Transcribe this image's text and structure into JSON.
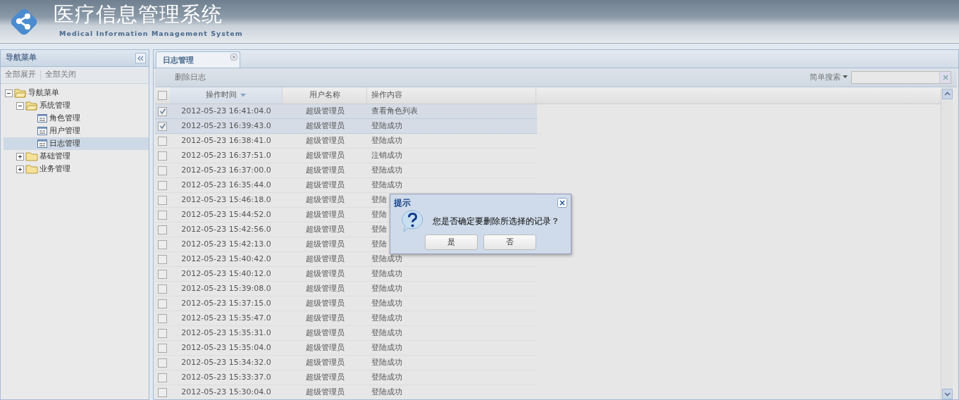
{
  "header": {
    "title": "医疗信息管理系统",
    "subtitle": "Medical Information Management System"
  },
  "sidebar": {
    "title": "导航菜单",
    "actions": [
      "全部展开",
      "全部关闭"
    ],
    "tree": [
      {
        "label": "导航菜单",
        "kind": "folder",
        "expanded": true,
        "selected": false,
        "children": [
          {
            "label": "系统管理",
            "kind": "folder",
            "expanded": true,
            "selected": false,
            "children": [
              {
                "label": "角色管理",
                "kind": "page",
                "selected": false
              },
              {
                "label": "用户管理",
                "kind": "page",
                "selected": false
              },
              {
                "label": "日志管理",
                "kind": "page",
                "selected": true
              }
            ]
          },
          {
            "label": "基础管理",
            "kind": "folder",
            "expanded": false,
            "selected": false
          },
          {
            "label": "业务管理",
            "kind": "folder",
            "expanded": false,
            "selected": false
          }
        ]
      }
    ]
  },
  "tabs": [
    {
      "label": "日志管理",
      "selected": true
    }
  ],
  "toolbar": {
    "delete": "删除日志",
    "search_menu": "简单搜索"
  },
  "table": {
    "all_checked": false,
    "columns": [
      {
        "label": "操作时间",
        "sorted": true
      },
      {
        "label": "用户名称",
        "sorted": false
      },
      {
        "label": "操作内容",
        "sorted": false
      }
    ],
    "rows": [
      {
        "time": "2012-05-23 16:41:04.0",
        "user": "超级管理员",
        "content": "查看角色列表",
        "checked": true
      },
      {
        "time": "2012-05-23 16:39:43.0",
        "user": "超级管理员",
        "content": "登陆成功",
        "checked": true
      },
      {
        "time": "2012-05-23 16:38:41.0",
        "user": "超级管理员",
        "content": "登陆成功",
        "checked": false
      },
      {
        "time": "2012-05-23 16:37:51.0",
        "user": "超级管理员",
        "content": "注销成功",
        "checked": false
      },
      {
        "time": "2012-05-23 16:37:00.0",
        "user": "超级管理员",
        "content": "登陆成功",
        "checked": false
      },
      {
        "time": "2012-05-23 16:35:44.0",
        "user": "超级管理员",
        "content": "登陆成功",
        "checked": false
      },
      {
        "time": "2012-05-23 15:46:18.0",
        "user": "超级管理员",
        "content": "登陆",
        "checked": false
      },
      {
        "time": "2012-05-23 15:44:52.0",
        "user": "超级管理员",
        "content": "登陆",
        "checked": false
      },
      {
        "time": "2012-05-23 15:42:56.0",
        "user": "超级管理员",
        "content": "登陆",
        "checked": false
      },
      {
        "time": "2012-05-23 15:42:13.0",
        "user": "超级管理员",
        "content": "登陆",
        "checked": false
      },
      {
        "time": "2012-05-23 15:40:42.0",
        "user": "超级管理员",
        "content": "登陆成功",
        "checked": false
      },
      {
        "time": "2012-05-23 15:40:12.0",
        "user": "超级管理员",
        "content": "登陆成功",
        "checked": false
      },
      {
        "time": "2012-05-23 15:39:08.0",
        "user": "超级管理员",
        "content": "登陆成功",
        "checked": false
      },
      {
        "time": "2012-05-23 15:37:15.0",
        "user": "超级管理员",
        "content": "登陆成功",
        "checked": false
      },
      {
        "time": "2012-05-23 15:35:47.0",
        "user": "超级管理员",
        "content": "登陆成功",
        "checked": false
      },
      {
        "time": "2012-05-23 15:35:31.0",
        "user": "超级管理员",
        "content": "登陆成功",
        "checked": false
      },
      {
        "time": "2012-05-23 15:35:04.0",
        "user": "超级管理员",
        "content": "登陆成功",
        "checked": false
      },
      {
        "time": "2012-05-23 15:34:32.0",
        "user": "超级管理员",
        "content": "登陆成功",
        "checked": false
      },
      {
        "time": "2012-05-23 15:33:37.0",
        "user": "超级管理员",
        "content": "登陆成功",
        "checked": false
      },
      {
        "time": "2012-05-23 15:30:04.0",
        "user": "超级管理员",
        "content": "登陆成功",
        "checked": false
      }
    ]
  },
  "dialog": {
    "title": "提示",
    "message": "您是否确定要删除所选择的记录？",
    "buttons": [
      "是",
      "否"
    ]
  }
}
